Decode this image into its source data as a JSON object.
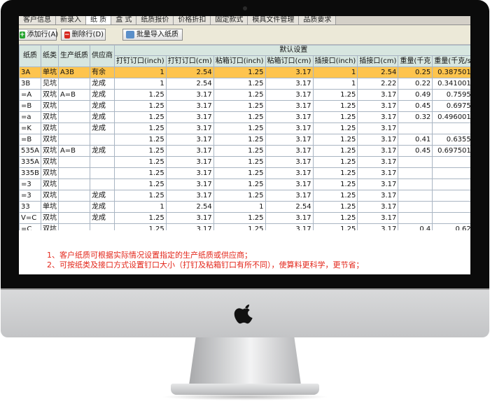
{
  "tabs": [
    "客户信息",
    "新录入",
    "纸 质",
    "盒 式",
    "纸质报价",
    "价格折扣",
    "固定款式",
    "模具文件管理",
    "品质要求"
  ],
  "active_tab": 2,
  "toolbar": {
    "add_label": "添加行(A)",
    "delete_label": "删除行(D)",
    "import_label": "批量导入纸质"
  },
  "table": {
    "group_header": "默认设置",
    "columns": [
      "纸质",
      "纸类",
      "生产纸质",
      "供应商",
      "打钉订口(inch)",
      "打钉订口(cm)",
      "粘箱订口(inch)",
      "粘箱订口(cm)",
      "插接口(inch)",
      "插接口(cm)",
      "重量(千克",
      "重量(千克/s"
    ],
    "rows": [
      [
        "3A",
        "单坑",
        "A3B",
        "有余",
        "1",
        "2.54",
        "1.25",
        "3.17",
        "1",
        "2.54",
        "0.25",
        "0.387501"
      ],
      [
        "3B",
        "见坑",
        "",
        "龙成",
        "1",
        "2.54",
        "1.25",
        "3.17",
        "1",
        "2.22",
        "0.22",
        "0.341001"
      ],
      [
        "=A",
        "双坑",
        "A=B",
        "龙成",
        "1.25",
        "3.17",
        "1.25",
        "3.17",
        "1.25",
        "3.17",
        "0.49",
        "0.7595"
      ],
      [
        "=B",
        "双坑",
        "",
        "龙成",
        "1.25",
        "3.17",
        "1.25",
        "3.17",
        "1.25",
        "3.17",
        "0.45",
        "0.6975"
      ],
      [
        "=a",
        "双坑",
        "",
        "龙成",
        "1.25",
        "3.17",
        "1.25",
        "3.17",
        "1.25",
        "3.17",
        "0.32",
        "0.496001"
      ],
      [
        "=K",
        "双坑",
        "",
        "龙成",
        "1.25",
        "3.17",
        "1.25",
        "3.17",
        "1.25",
        "3.17",
        "",
        ""
      ],
      [
        "=B",
        "双坑",
        "",
        "",
        "1.25",
        "3.17",
        "1.25",
        "3.17",
        "1.25",
        "3.17",
        "0.41",
        "0.6355"
      ],
      [
        "535A",
        "双坑",
        "A=B",
        "龙成",
        "1.25",
        "3.17",
        "1.25",
        "3.17",
        "1.25",
        "3.17",
        "0.45",
        "0.697501"
      ],
      [
        "335A",
        "双坑",
        "",
        "",
        "1.25",
        "3.17",
        "1.25",
        "3.17",
        "1.25",
        "3.17",
        "",
        ""
      ],
      [
        "335B",
        "双坑",
        "",
        "",
        "1.25",
        "3.17",
        "1.25",
        "3.17",
        "1.25",
        "3.17",
        "",
        ""
      ],
      [
        "=3",
        "双坑",
        "",
        "",
        "1.25",
        "3.17",
        "1.25",
        "3.17",
        "1.25",
        "3.17",
        "",
        ""
      ],
      [
        "=3",
        "双坑",
        "",
        "龙成",
        "1.25",
        "3.17",
        "1.25",
        "3.17",
        "1.25",
        "3.17",
        "",
        ""
      ],
      [
        "33",
        "单坑",
        "",
        "龙成",
        "1",
        "2.54",
        "1",
        "2.54",
        "1.25",
        "3.17",
        "",
        ""
      ],
      [
        "V=C",
        "双坑",
        "",
        "龙成",
        "1.25",
        "3.17",
        "1.25",
        "3.17",
        "1.25",
        "3.17",
        "",
        ""
      ],
      [
        "=C",
        "双坑",
        "",
        "",
        "1.25",
        "3.17",
        "1.25",
        "3.17",
        "1.25",
        "3.17",
        "0.4",
        "0.62"
      ],
      [
        "V33",
        "单坑",
        "",
        "",
        "1",
        "2.54",
        "1",
        "2.54",
        "1.25",
        "3.17",
        "",
        ""
      ]
    ]
  },
  "notes": [
    "1、客户纸质可根据实际情况设置指定的生产纸质或供应商；",
    "2、可按纸类及接口方式设置钉口大小（打钉及粘箱钉口有所不同），使算料更科学，更节省；"
  ],
  "colors": {
    "selected_row": "#fec44d",
    "note_text": "#e3261a",
    "header_bg": "#d7e6e0"
  }
}
